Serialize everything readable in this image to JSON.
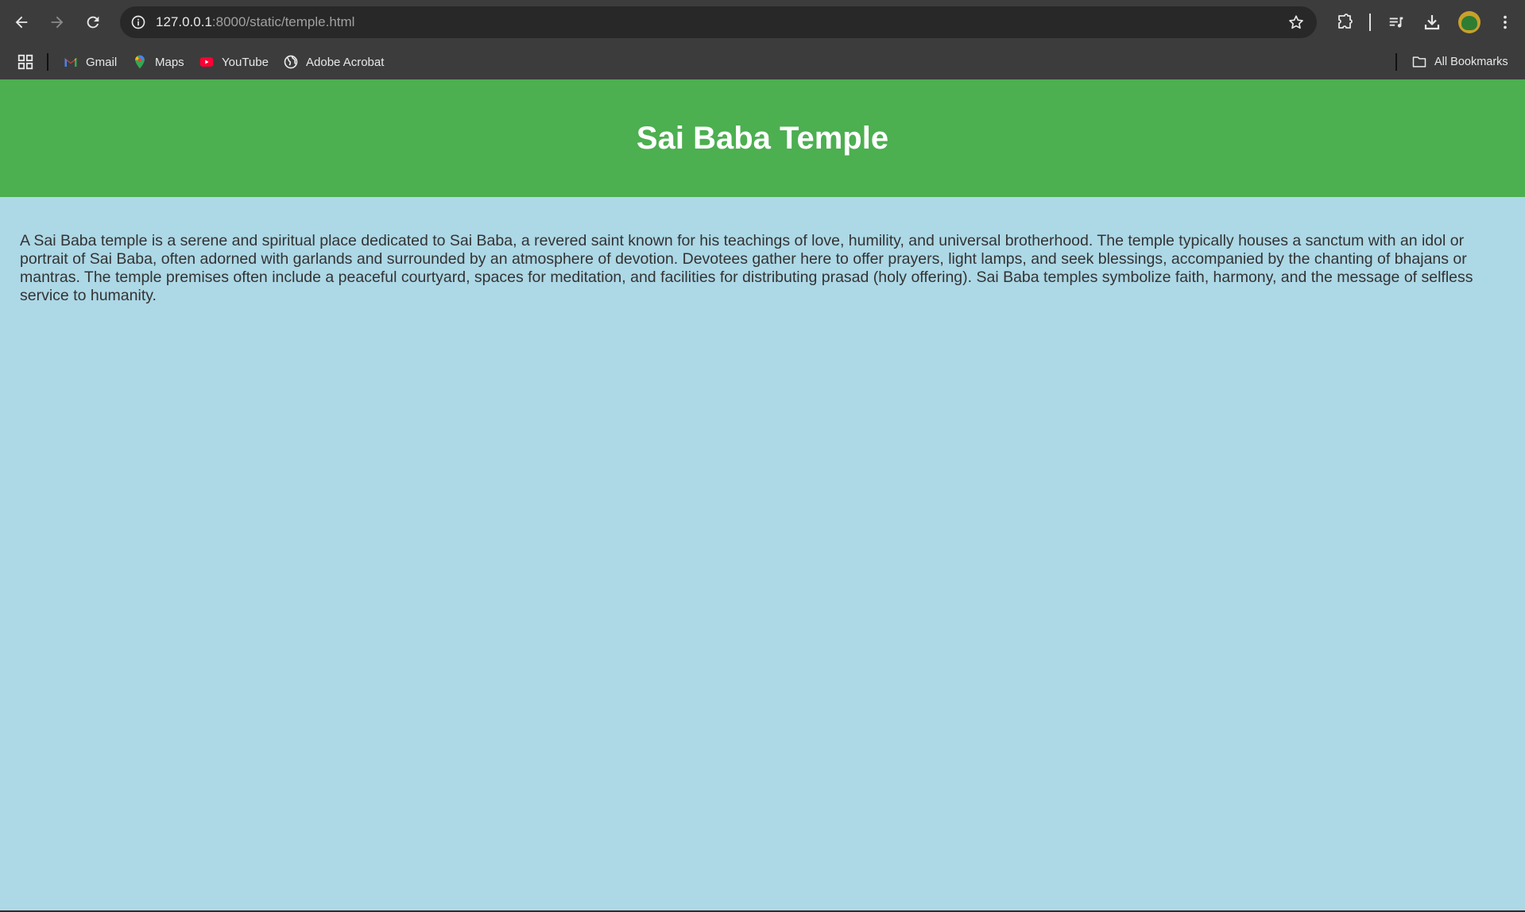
{
  "browser": {
    "url_host": "127.0.0.1",
    "url_path": ":8000/static/temple.html",
    "icons": {
      "back": "back-arrow-icon",
      "forward": "forward-arrow-icon",
      "reload": "reload-icon",
      "site_info": "site-info-icon",
      "bookmark_star": "star-icon",
      "extensions": "puzzle-icon",
      "media": "media-queue-icon",
      "downloads": "download-icon",
      "menu": "kebab-menu-icon"
    },
    "bookmarks": [
      {
        "label": "Gmail",
        "icon": "gmail-icon"
      },
      {
        "label": "Maps",
        "icon": "maps-icon"
      },
      {
        "label": "YouTube",
        "icon": "youtube-icon"
      },
      {
        "label": "Adobe Acrobat",
        "icon": "globe-icon"
      }
    ],
    "all_bookmarks_label": "All Bookmarks"
  },
  "page": {
    "title": "Sai Baba Temple",
    "description": "A Sai Baba temple is a serene and spiritual place dedicated to Sai Baba, a revered saint known for his teachings of love, humility, and universal brotherhood. The temple typically houses a sanctum with an idol or portrait of Sai Baba, often adorned with garlands and surrounded by an atmosphere of devotion. Devotees gather here to offer prayers, light lamps, and seek blessings, accompanied by the chanting of bhajans or mantras. The temple premises often include a peaceful courtyard, spaces for meditation, and facilities for distributing prasad (holy offering). Sai Baba temples symbolize faith, harmony, and the message of selfless service to humanity."
  },
  "colors": {
    "header_green": "#4caf50",
    "page_background": "#add8e6",
    "chrome_dark": "#3c3c3c"
  }
}
